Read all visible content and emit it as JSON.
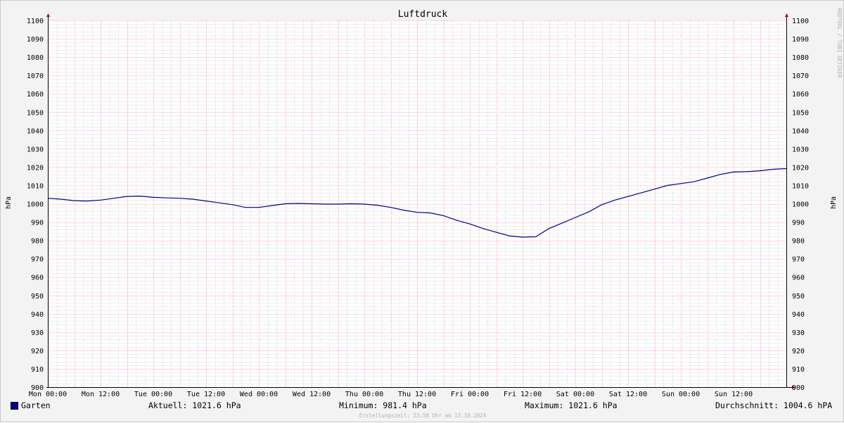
{
  "chart_data": {
    "type": "line",
    "title": "Luftdruck",
    "ylabel": "hPa",
    "ylim": [
      900,
      1100
    ],
    "ytick_step": 10,
    "yticks": [
      "900",
      "910",
      "920",
      "930",
      "940",
      "950",
      "960",
      "970",
      "980",
      "990",
      "1000",
      "1010",
      "1020",
      "1030",
      "1040",
      "1050",
      "1060",
      "1070",
      "1080",
      "1090",
      "1100"
    ],
    "x_labels": [
      "Mon 00:00",
      "Mon 12:00",
      "Tue 00:00",
      "Tue 12:00",
      "Wed 00:00",
      "Wed 12:00",
      "Thu 00:00",
      "Thu 12:00",
      "Fri 00:00",
      "Fri 12:00",
      "Sat 00:00",
      "Sat 12:00",
      "Sun 00:00",
      "Sun 12:00"
    ],
    "x_range_hours": [
      0,
      168
    ],
    "grid": true,
    "legend_position": "bottom-left",
    "series": [
      {
        "name": "Garten",
        "color": "#00008b",
        "points": [
          [
            0,
            1003.0
          ],
          [
            3,
            1002.5
          ],
          [
            6,
            1001.7
          ],
          [
            9,
            1001.5
          ],
          [
            12,
            1002.0
          ],
          [
            15,
            1003.0
          ],
          [
            18,
            1004.0
          ],
          [
            21,
            1004.2
          ],
          [
            24,
            1003.5
          ],
          [
            27,
            1003.2
          ],
          [
            30,
            1003.0
          ],
          [
            33,
            1002.5
          ],
          [
            36,
            1001.5
          ],
          [
            39,
            1000.5
          ],
          [
            42,
            999.5
          ],
          [
            45,
            998.0
          ],
          [
            48,
            998.0
          ],
          [
            51,
            999.0
          ],
          [
            54,
            1000.0
          ],
          [
            57,
            1000.2
          ],
          [
            60,
            1000.0
          ],
          [
            63,
            999.8
          ],
          [
            66,
            999.8
          ],
          [
            69,
            1000.0
          ],
          [
            72,
            999.8
          ],
          [
            75,
            999.2
          ],
          [
            78,
            998.0
          ],
          [
            81,
            996.5
          ],
          [
            84,
            995.3
          ],
          [
            87,
            995.0
          ],
          [
            90,
            993.5
          ],
          [
            93,
            991.0
          ],
          [
            96,
            989.0
          ],
          [
            99,
            986.5
          ],
          [
            102,
            984.5
          ],
          [
            105,
            982.5
          ],
          [
            108,
            981.8
          ],
          [
            111,
            982.0
          ],
          [
            114,
            986.5
          ],
          [
            117,
            989.5
          ],
          [
            120,
            992.5
          ],
          [
            123,
            995.5
          ],
          [
            126,
            999.5
          ],
          [
            129,
            1002.0
          ],
          [
            132,
            1004.0
          ],
          [
            135,
            1006.0
          ],
          [
            138,
            1008.0
          ],
          [
            141,
            1010.0
          ],
          [
            144,
            1011.0
          ],
          [
            147,
            1012.0
          ],
          [
            150,
            1014.0
          ],
          [
            153,
            1016.0
          ],
          [
            156,
            1017.3
          ],
          [
            159,
            1017.5
          ],
          [
            162,
            1018.0
          ],
          [
            165,
            1018.8
          ],
          [
            168,
            1019.2
          ]
        ]
      }
    ]
  },
  "legend": {
    "series_name": "Garten",
    "series_color": "#000099",
    "aktuell": "Aktuell: 1021.6 hPa",
    "minimum": "Minimum: 981.4 hPa",
    "maximum": "Maximum: 1021.6 hPa",
    "durchschnitt": "Durchschnitt: 1004.6 hPA"
  },
  "watermark": "RRDTOOL / TOBI OETIKER",
  "footer": "Erstellungszeit: 23:58 Uhr am 13.10.2024",
  "colors": {
    "grid_major": "#ffb0b0",
    "grid_minor": "#dddddd",
    "axis": "#000000",
    "arrow": "#b00000"
  }
}
